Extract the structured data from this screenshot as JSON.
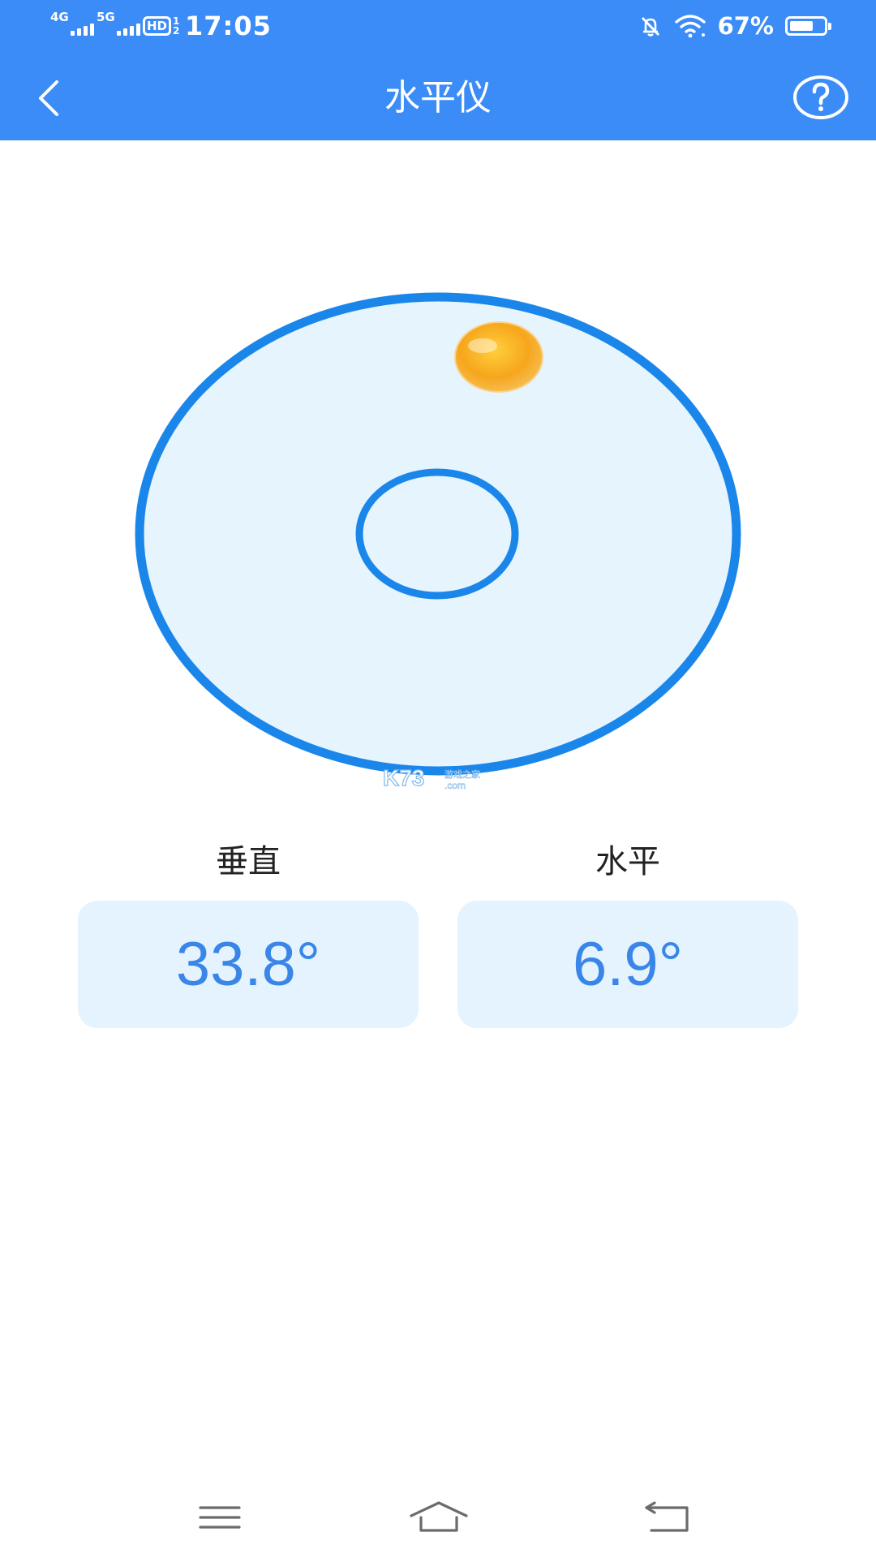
{
  "status_bar": {
    "network1": "4G",
    "network2": "5G",
    "hd_label": "HD",
    "hd_sub_top": "1",
    "hd_sub_bottom": "2",
    "time": "17:05",
    "battery": "67%"
  },
  "header": {
    "title": "水平仪",
    "back_icon": "chevron-left-icon",
    "help_icon": "question-circle-icon"
  },
  "level": {
    "bubble_color": "#f5a21b",
    "ring_color": "#1b86ea",
    "fill_color": "#e6f4fd"
  },
  "readings": {
    "vertical": {
      "label": "垂直",
      "value": "33.8°"
    },
    "horizontal": {
      "label": "水平",
      "value": "6.9°"
    }
  },
  "watermark": {
    "brand": "K73",
    "cn": "游戏之家",
    "domain": ".com"
  },
  "nav_bar": {
    "menu_icon": "menu-icon",
    "home_icon": "home-icon",
    "back_icon": "back-icon"
  },
  "colors": {
    "primary": "#3b8cf7",
    "value_text": "#3a86e8",
    "value_bg": "#e4f3fd"
  }
}
